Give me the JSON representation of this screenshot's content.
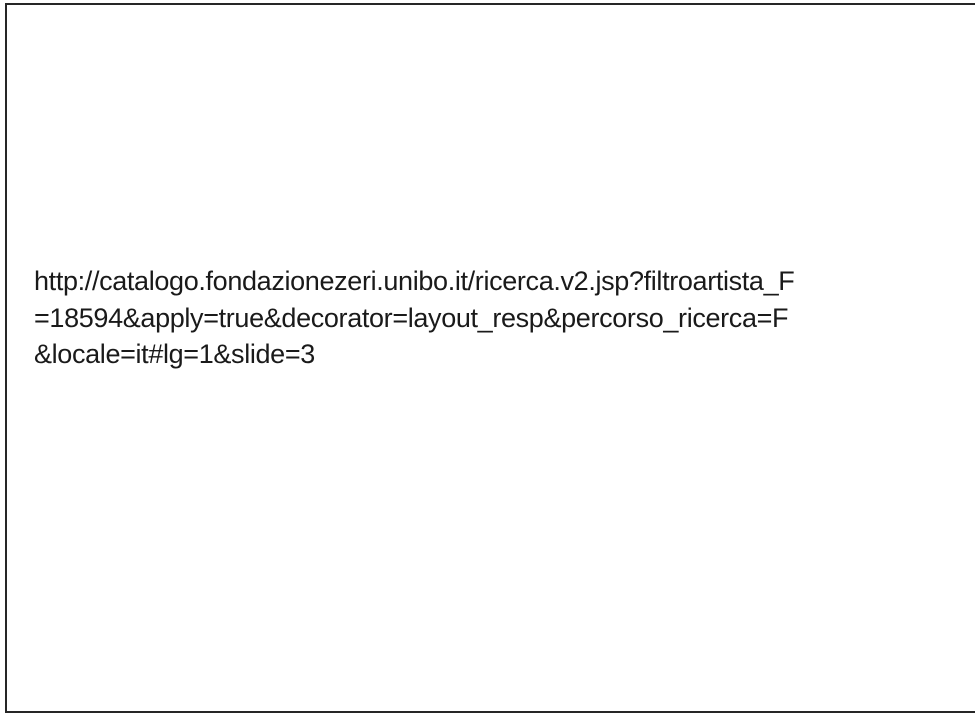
{
  "document": {
    "url_lines": [
      "http://catalogo.fondazionezeri.unibo.it/ricerca.v2.jsp?filtroartista_F",
      "=18594&apply=true&decorator=layout_resp&percorso_ricerca=F",
      "&locale=it#lg=1&slide=3"
    ]
  },
  "colors": {
    "text": "#1a1a1a",
    "border": "#262626",
    "background": "#ffffff"
  }
}
